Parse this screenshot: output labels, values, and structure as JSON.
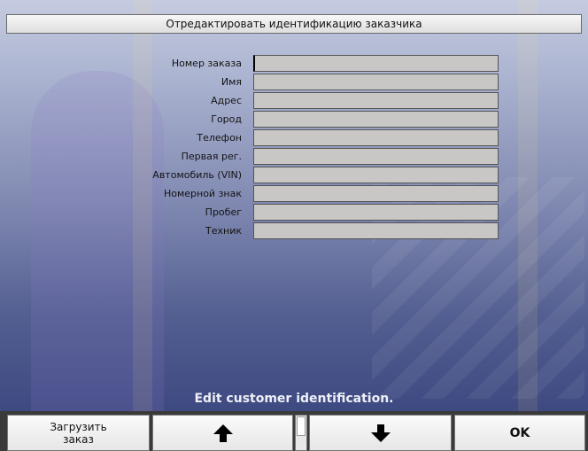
{
  "window": {
    "title": "Отредактировать идентификацию заказчика"
  },
  "fields": [
    {
      "label": "Номер заказа",
      "value": ""
    },
    {
      "label": "Имя",
      "value": ""
    },
    {
      "label": "Адрес",
      "value": ""
    },
    {
      "label": "Город",
      "value": ""
    },
    {
      "label": "Телефон",
      "value": ""
    },
    {
      "label": "Первая рег.",
      "value": ""
    },
    {
      "label": "Автомобиль (VIN)",
      "value": ""
    },
    {
      "label": "Номерной знак",
      "value": ""
    },
    {
      "label": "Пробег",
      "value": ""
    },
    {
      "label": "Техник",
      "value": ""
    }
  ],
  "hint": "Edit customer identification.",
  "buttons": {
    "load_line1": "Загрузить",
    "load_line2": "заказ",
    "up_icon": "arrow-up-icon",
    "down_icon": "arrow-down-icon",
    "ok": "OK"
  }
}
